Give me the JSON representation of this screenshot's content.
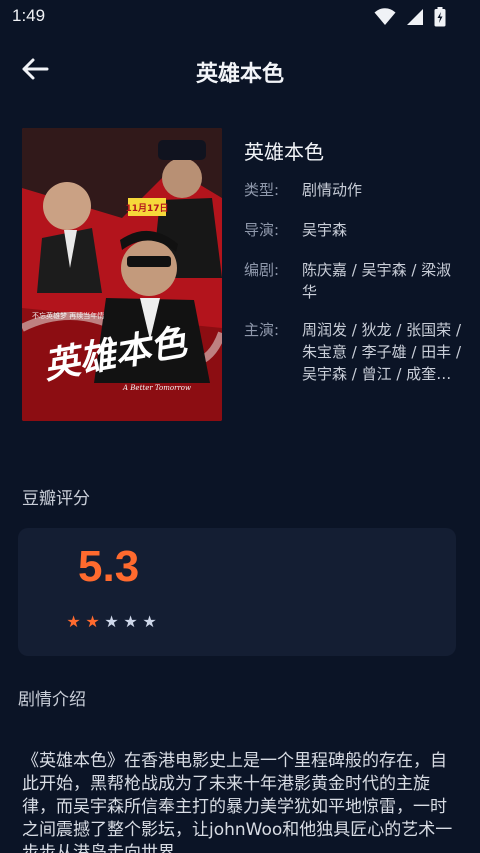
{
  "status_bar": {
    "time": "1:49"
  },
  "header": {
    "title": "英雄本色"
  },
  "movie": {
    "title": "英雄本色",
    "info": [
      {
        "label": "类型:",
        "value": "剧情动作"
      },
      {
        "label": "导演:",
        "value": "吴宇森"
      },
      {
        "label": "编剧:",
        "value": "陈庆嘉 / 吴宇森 / 梁淑华"
      },
      {
        "label": "主演:",
        "value": "周润发 / 狄龙 / 张国荣 / 朱宝意 / 李子雄 / 田丰 / 吴宇森 / 曾江 / 成奎安 / 石天"
      }
    ],
    "poster": {
      "title_art": "英雄本色",
      "english": "A Better Tomorrow",
      "date_tag": "11月17日",
      "tagline": "不忘英雄梦 再续当年情"
    }
  },
  "rating": {
    "section_label": "豆瓣评分",
    "score": "5.3",
    "stars": 2,
    "max_stars": 5,
    "filled_color": "#ff6a2e",
    "empty_color": "#cfd8ea"
  },
  "synopsis": {
    "section_label": "剧情介绍",
    "text": "《英雄本色》在香港电影史上是一个里程碑般的存在，自此开始，黑帮枪战成为了未来十年港影黄金时代的主旋律，而吴宇森所信奉主打的暴力美学犹如平地惊雷，一时之间震撼了整个影坛，让johnWoo和他独具匠心的艺术一步步从港岛走向世界。"
  },
  "colors": {
    "background": "#0b1426",
    "card": "#141e33",
    "accent": "#ff6a2e"
  }
}
